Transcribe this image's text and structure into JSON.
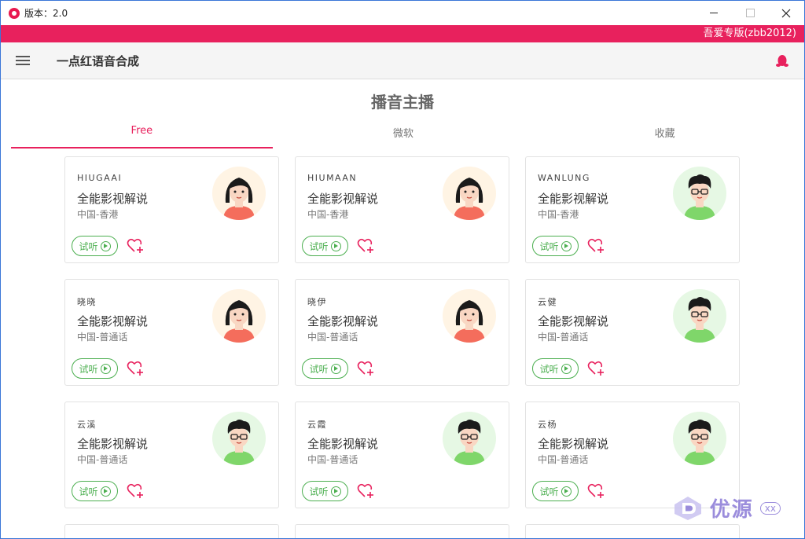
{
  "window": {
    "title": "版本：2.0"
  },
  "banner": {
    "text": "吾爱专版(zbb2012)"
  },
  "appbar": {
    "title": "一点红语音合成"
  },
  "page": {
    "section_title": "播音主播"
  },
  "tabs": [
    {
      "label": "Free",
      "active": true
    },
    {
      "label": "微软",
      "active": false
    },
    {
      "label": "收藏",
      "active": false
    }
  ],
  "listen_label": "试听",
  "cards": [
    {
      "id": "HIUGAAI",
      "desc": "全能影视解说",
      "region": "中国-香港",
      "avatar": "female"
    },
    {
      "id": "HIUMAAN",
      "desc": "全能影视解说",
      "region": "中国-香港",
      "avatar": "female"
    },
    {
      "id": "WANLUNG",
      "desc": "全能影视解说",
      "region": "中国-香港",
      "avatar": "male"
    },
    {
      "id": "晓晓",
      "desc": "全能影视解说",
      "region": "中国-普通话",
      "avatar": "female"
    },
    {
      "id": "晓伊",
      "desc": "全能影视解说",
      "region": "中国-普通话",
      "avatar": "female"
    },
    {
      "id": "云健",
      "desc": "全能影视解说",
      "region": "中国-普通话",
      "avatar": "male"
    },
    {
      "id": "云溪",
      "desc": "全能影视解说",
      "region": "中国-普通话",
      "avatar": "male"
    },
    {
      "id": "云霞",
      "desc": "全能影视解说",
      "region": "中国-普通话",
      "avatar": "male"
    },
    {
      "id": "云杨",
      "desc": "全能影视解说",
      "region": "中国-普通话",
      "avatar": "male"
    }
  ],
  "watermark": {
    "text": "优源",
    "sub": "xx"
  },
  "colors": {
    "accent": "#e8215d",
    "listen": "#4caf50",
    "fav": "#e8215d"
  }
}
